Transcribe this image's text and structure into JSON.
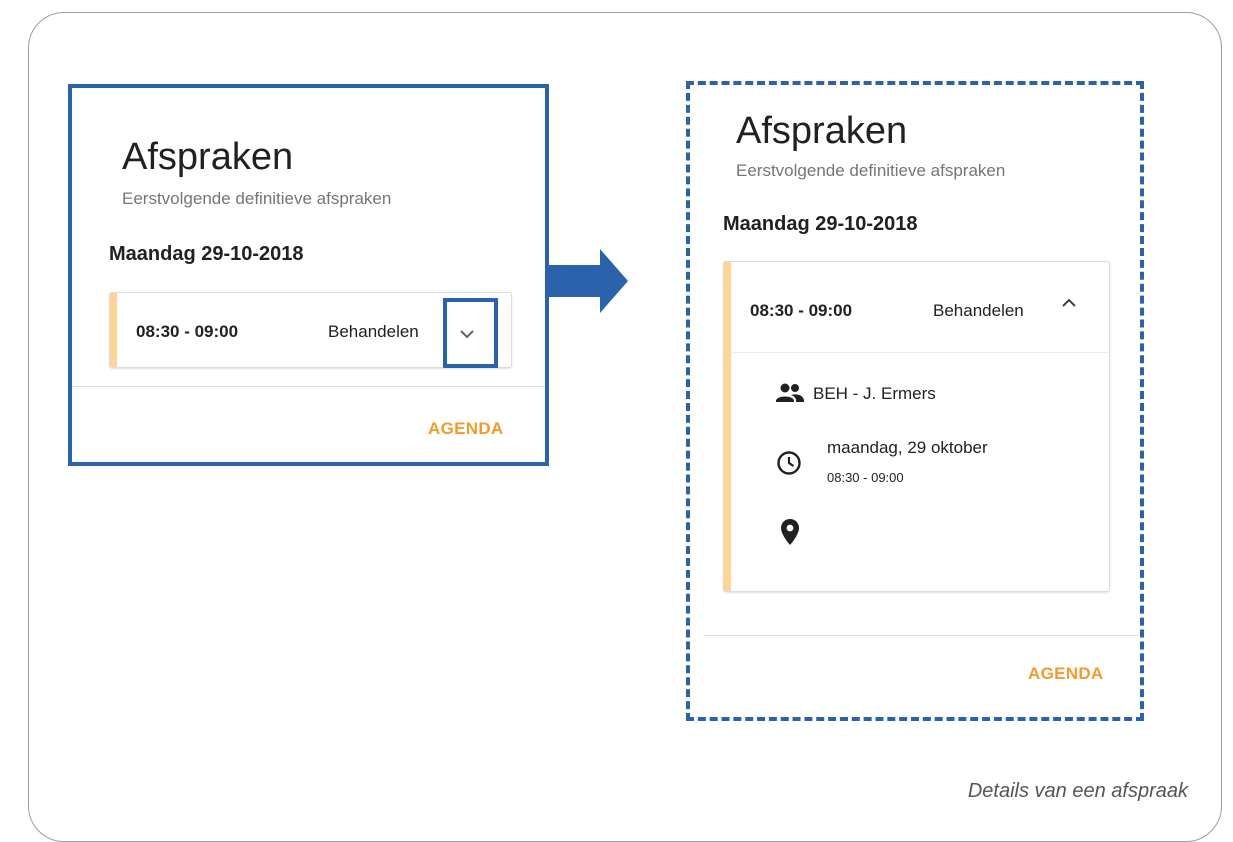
{
  "collapsed": {
    "title": "Afspraken",
    "subtitle": "Eerstvolgende definitieve afspraken",
    "date": "Maandag 29-10-2018",
    "appointment": {
      "time": "08:30 - 09:00",
      "type": "Behandelen",
      "expanded": false
    },
    "agenda_label": "AGENDA"
  },
  "expanded": {
    "title": "Afspraken",
    "subtitle": "Eerstvolgende definitieve afspraken",
    "date": "Maandag 29-10-2018",
    "appointment": {
      "time": "08:30 - 09:00",
      "type": "Behandelen",
      "expanded": true,
      "participants": "BEH - J. Ermers",
      "day": "maandag, 29 oktober",
      "time_detail": "08:30 - 09:00",
      "location": ""
    },
    "agenda_label": "AGENDA"
  },
  "caption": "Details van een afspraak",
  "colors": {
    "accent": "#2a62ac",
    "agenda": "#f39a2e",
    "appointment_bar": "#ffd596"
  },
  "icons": [
    "chevron-down-icon",
    "chevron-up-icon",
    "people-icon",
    "clock-icon",
    "location-pin-icon",
    "right-arrow-icon"
  ]
}
